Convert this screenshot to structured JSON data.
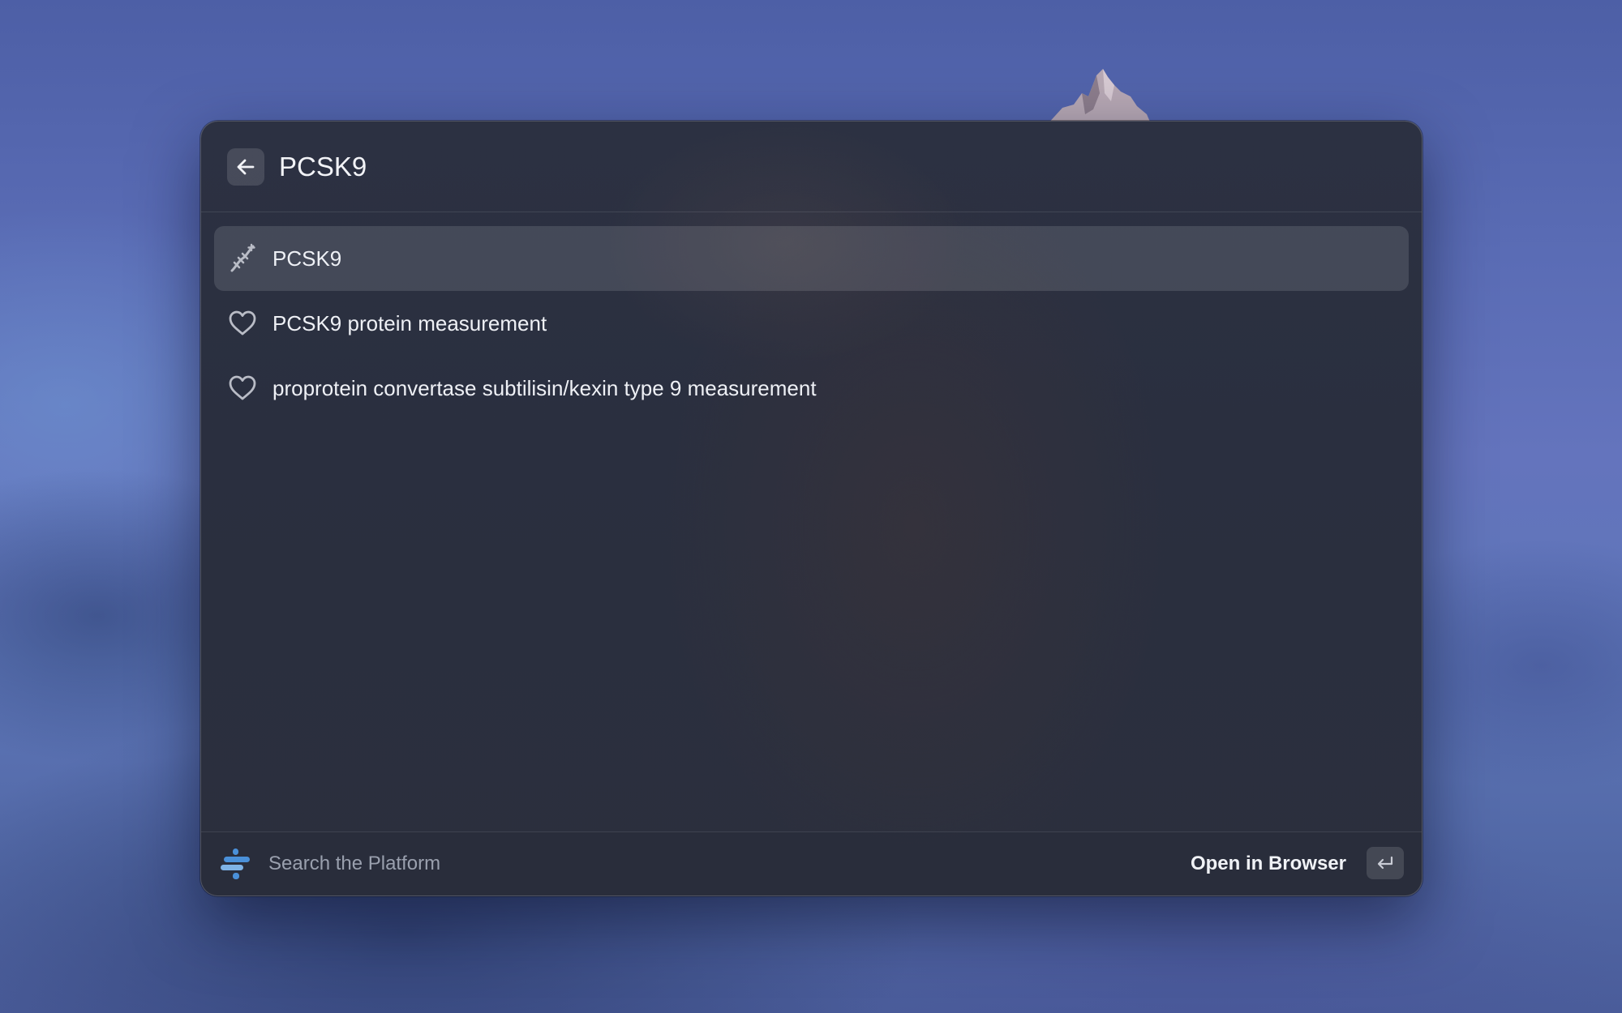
{
  "search": {
    "query": "PCSK9",
    "back_icon": "arrow-left-icon"
  },
  "results": [
    {
      "label": "PCSK9",
      "icon": "dna-icon",
      "selected": true
    },
    {
      "label": "PCSK9 protein measurement",
      "icon": "heart-icon",
      "selected": false
    },
    {
      "label": "proprotein convertase subtilisin/kexin type 9 measurement",
      "icon": "heart-icon",
      "selected": false
    }
  ],
  "footer": {
    "hint": "Search the Platform",
    "action_label": "Open in Browser",
    "action_key_icon": "return-key-icon",
    "logo_icon": "platform-logo-icon"
  },
  "colors": {
    "accent": "#4a90d9",
    "text": "#eef0f5",
    "muted": "#9aa0ae"
  }
}
